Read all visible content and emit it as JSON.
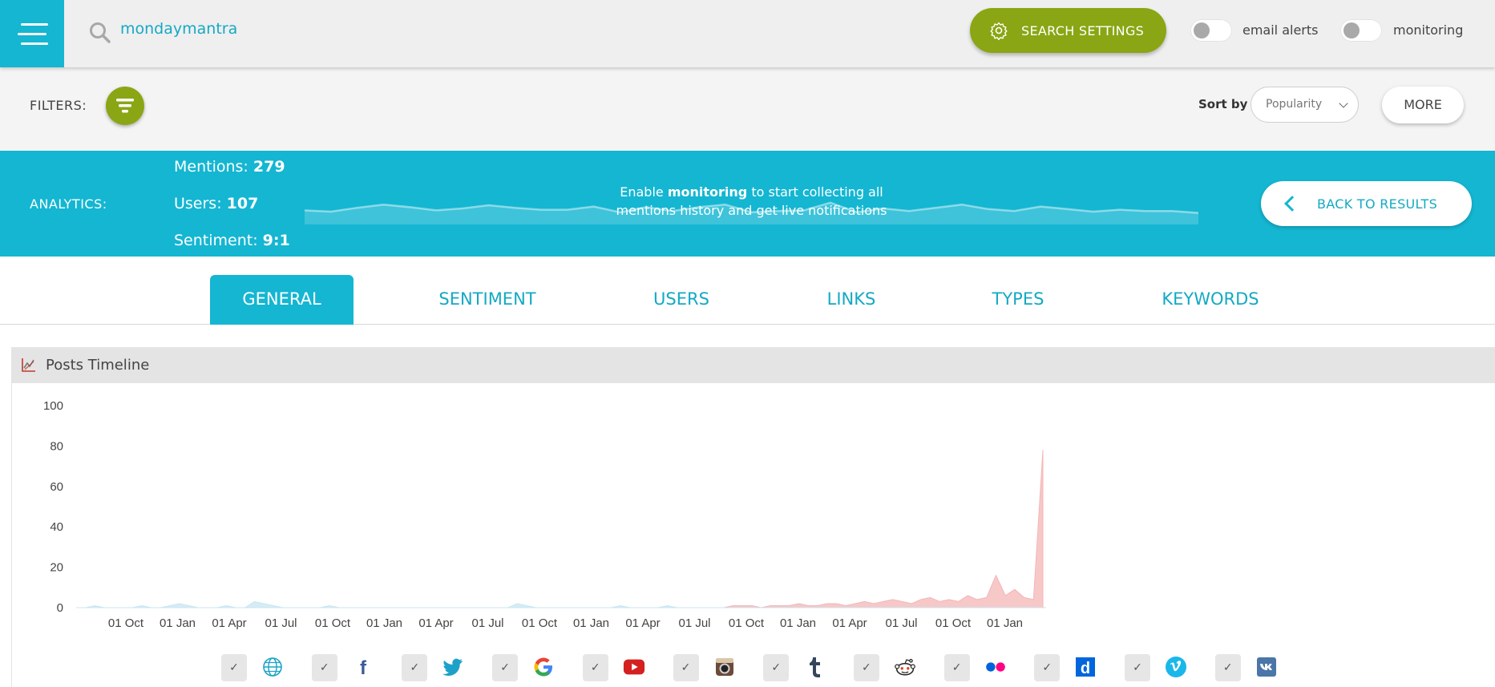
{
  "header": {
    "search_query": "mondaymantra",
    "search_settings_label": "SEARCH SETTINGS",
    "email_alerts_label": "email alerts",
    "monitoring_label": "monitoring"
  },
  "filters": {
    "label": "FILTERS:",
    "sort_by_label": "Sort by",
    "sort_value": "Popularity",
    "more_label": "MORE"
  },
  "analytics": {
    "label": "ANALYTICS:",
    "mentions_label": "Mentions:",
    "mentions_value": "279",
    "users_label": "Users:",
    "users_value": "107",
    "sentiment_label": "Sentiment:",
    "sentiment_value": "9:1",
    "msg_pre": "Enable ",
    "msg_bold": "monitoring",
    "msg_post": " to start collecting all mentions history and get live notifications",
    "back_label": "BACK TO RESULTS"
  },
  "tabs": [
    {
      "label": "GENERAL",
      "active": true
    },
    {
      "label": "SENTIMENT",
      "active": false
    },
    {
      "label": "USERS",
      "active": false
    },
    {
      "label": "LINKS",
      "active": false
    },
    {
      "label": "TYPES",
      "active": false
    },
    {
      "label": "KEYWORDS",
      "active": false
    }
  ],
  "panel": {
    "title": "Posts Timeline"
  },
  "chart_data": {
    "type": "area",
    "title": "",
    "xlabel": "",
    "ylabel": "",
    "ylim": [
      0,
      100
    ],
    "yticks": [
      0,
      20,
      40,
      60,
      80,
      100
    ],
    "x_tick_labels": [
      "01 Oct",
      "01 Jan",
      "01 Apr",
      "01 Jul",
      "01 Oct",
      "01 Jan",
      "01 Apr",
      "01 Jul",
      "01 Oct",
      "01 Jan",
      "01 Apr",
      "01 Jul",
      "01 Oct",
      "01 Jan",
      "01 Apr",
      "01 Jul",
      "01 Oct",
      "01 Jan"
    ],
    "grid": false,
    "series": [
      {
        "color": "#f4b6b6",
        "values": [
          0,
          0,
          0,
          0,
          0,
          0,
          0,
          0,
          0,
          0,
          0,
          0,
          0,
          0,
          0,
          0,
          0,
          0,
          0,
          0,
          0,
          0,
          0,
          0,
          0,
          0,
          0,
          0,
          0,
          0,
          0,
          0,
          0,
          0,
          0,
          0,
          0,
          0,
          0,
          0,
          0,
          0,
          0,
          0,
          0,
          0,
          0,
          0,
          0,
          0,
          0,
          0,
          0,
          0,
          0,
          0,
          0,
          0,
          0,
          0,
          0,
          0,
          0,
          0,
          0,
          0,
          0,
          0,
          0,
          0,
          1,
          1,
          1,
          0,
          1,
          1,
          1,
          2,
          1,
          1,
          2,
          2,
          1,
          2,
          3,
          2,
          3,
          4,
          3,
          2,
          4,
          5,
          3,
          4,
          3,
          6,
          4,
          5,
          16,
          6,
          9,
          5,
          4,
          78
        ]
      },
      {
        "color": "#c8e6f2",
        "values": [
          0,
          0,
          1,
          0,
          0,
          0,
          0,
          1,
          0,
          0,
          1,
          2,
          1,
          0,
          0,
          0,
          1,
          0,
          0,
          3,
          2,
          1,
          0,
          0,
          0,
          0,
          0,
          1,
          0,
          0,
          0,
          0,
          0,
          0,
          0,
          0,
          0,
          0,
          0,
          0,
          0,
          0,
          0,
          0,
          0,
          0,
          0,
          2,
          1,
          0,
          0,
          0,
          0,
          0,
          0,
          0,
          0,
          0,
          1,
          0,
          0,
          0,
          0,
          1,
          0,
          0,
          0,
          0,
          0,
          0,
          0,
          0,
          0,
          0,
          0,
          0,
          0,
          0,
          0,
          0,
          0,
          0,
          0,
          0,
          0,
          0,
          0,
          0,
          0,
          0,
          0,
          0,
          0,
          0,
          0,
          0,
          0,
          0,
          0,
          0,
          0,
          0,
          0,
          0
        ]
      }
    ]
  },
  "sparkline": {
    "values": [
      22,
      20,
      26,
      31,
      27,
      22,
      25,
      30,
      26,
      23,
      23,
      28,
      19,
      27,
      21,
      27,
      31,
      19,
      21,
      22,
      34,
      19,
      25,
      21,
      26,
      31,
      24,
      21,
      28,
      24,
      20,
      23,
      21,
      21,
      18
    ]
  },
  "sources": [
    {
      "name": "web",
      "icon": "globe-icon",
      "check": "✓"
    },
    {
      "name": "facebook",
      "icon": "facebook-icon",
      "check": "✓"
    },
    {
      "name": "twitter",
      "icon": "twitter-icon",
      "check": "✓"
    },
    {
      "name": "google",
      "icon": "google-icon",
      "check": "✓"
    },
    {
      "name": "youtube",
      "icon": "youtube-icon",
      "check": "✓"
    },
    {
      "name": "instagram",
      "icon": "instagram-icon",
      "check": "✓"
    },
    {
      "name": "tumblr",
      "icon": "tumblr-icon",
      "check": "✓"
    },
    {
      "name": "reddit",
      "icon": "reddit-icon",
      "check": "✓"
    },
    {
      "name": "flickr",
      "icon": "flickr-icon",
      "check": "✓"
    },
    {
      "name": "dailymotion",
      "icon": "dailymotion-icon",
      "check": "✓"
    },
    {
      "name": "vimeo",
      "icon": "vimeo-icon",
      "check": "✓"
    },
    {
      "name": "vk",
      "icon": "vk-icon",
      "check": "✓"
    }
  ],
  "colors": {
    "accent": "#14b6d2",
    "green": "#8aa614"
  }
}
